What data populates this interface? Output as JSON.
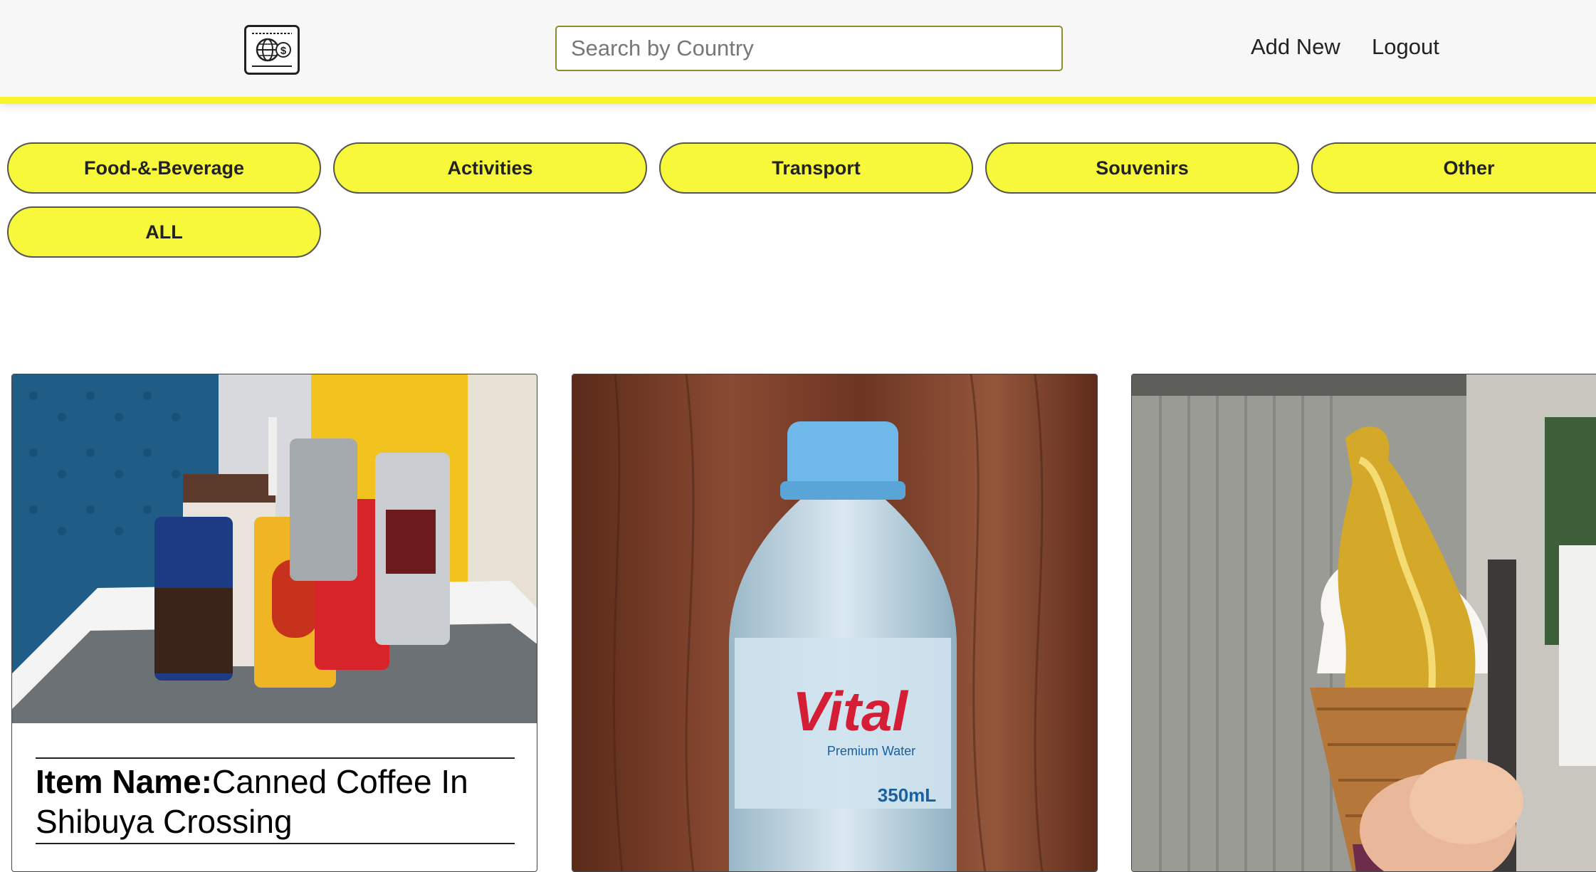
{
  "header": {
    "logo_icon": "globe-dollar-card-icon",
    "search": {
      "placeholder": "Search by Country",
      "value": ""
    },
    "nav": {
      "add_new": "Add New",
      "logout": "Logout"
    },
    "accent_color": "#f8f52a"
  },
  "filters": {
    "categories": [
      "Food-&-Beverage",
      "Activities",
      "Transport",
      "Souvenirs",
      "Other",
      "ALL"
    ],
    "pill_color": "#f8f83a"
  },
  "cards": [
    {
      "image": "canned-coffee-photo",
      "label": "Item Name:",
      "name": "Canned Coffee In Shibuya Crossing"
    },
    {
      "image": "vital-water-bottle-photo",
      "brand": "Vital",
      "brand_sub": "Premium Water",
      "volume": "350mL"
    },
    {
      "image": "gold-leaf-ice-cream-photo"
    }
  ]
}
